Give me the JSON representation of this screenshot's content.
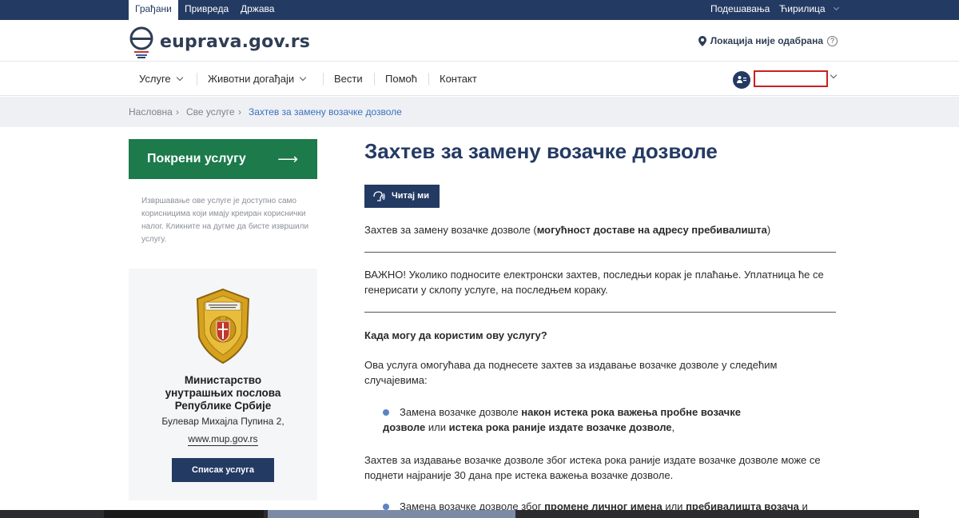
{
  "topbar": {
    "tabs": [
      "Грађани",
      "Привреда",
      "Држава"
    ],
    "settings": "Подешавања",
    "script": "Ћирилица"
  },
  "header": {
    "brand": "euprava.gov.rs",
    "location": "Локација није одабрана",
    "help": "?"
  },
  "nav": {
    "items": [
      "Услуге",
      "Животни догађаји",
      "Вести",
      "Помоћ",
      "Контакт"
    ]
  },
  "breadcrumb": {
    "home": "Насловна",
    "services": "Све услуге",
    "current": "Захтев за замену возачке дозволе"
  },
  "sidebar": {
    "start_label": "Покрени услугу",
    "start_arrow": "⟶",
    "note": "Извршавање ове услуге је доступно само корисницима који имају креиран кориснички налог. Кликните на дугме да бисте извршили услугу.",
    "org_name": "Министарство унутрашњих послова Републике Србије",
    "address": "Булевар Михајла Пупина 2,",
    "website": "www.mup.gov.rs",
    "list_button": "Списак услуга"
  },
  "main": {
    "title": "Захтев за замену возачке дозволе",
    "read_button": "Читај ми",
    "intro_plain": "Захтев за замену возачке дозволе (",
    "intro_bold": "могућност доставе на адресу пребивалишта",
    "intro_end": ")",
    "important": "ВАЖНО! Уколико подносите електронски захтев, последњи корак је плаћање. Уплатница ће се генерисати у склопу услуге, на последњем кораку.",
    "when_heading": "Када могу да користим ову услугу?",
    "when_text": "Ова услуга омогућава да поднесете захтев за издавање возачке дозволе у следећим случајевима:",
    "bullet1_a": "Замена возачке дозволе ",
    "bullet1_b": "након истека рока важења пробне возачке дозволе",
    "bullet1_c": " или ",
    "bullet1_d": "истека рока раније издате возачке дозволе",
    "bullet1_e": ",",
    "expiry_text": "Захтев за издавање возачке дозволе због истека рока раније издате возачке дозволе може се поднети најраније 30 дана пре истека важења возачке дозволе.",
    "bullet2_a": "Замена возачке дозволе због ",
    "bullet2_b": "промене личног имена",
    "bullet2_c": " или ",
    "bullet2_d": "пребивалишта возача",
    "bullet2_e": " и"
  }
}
